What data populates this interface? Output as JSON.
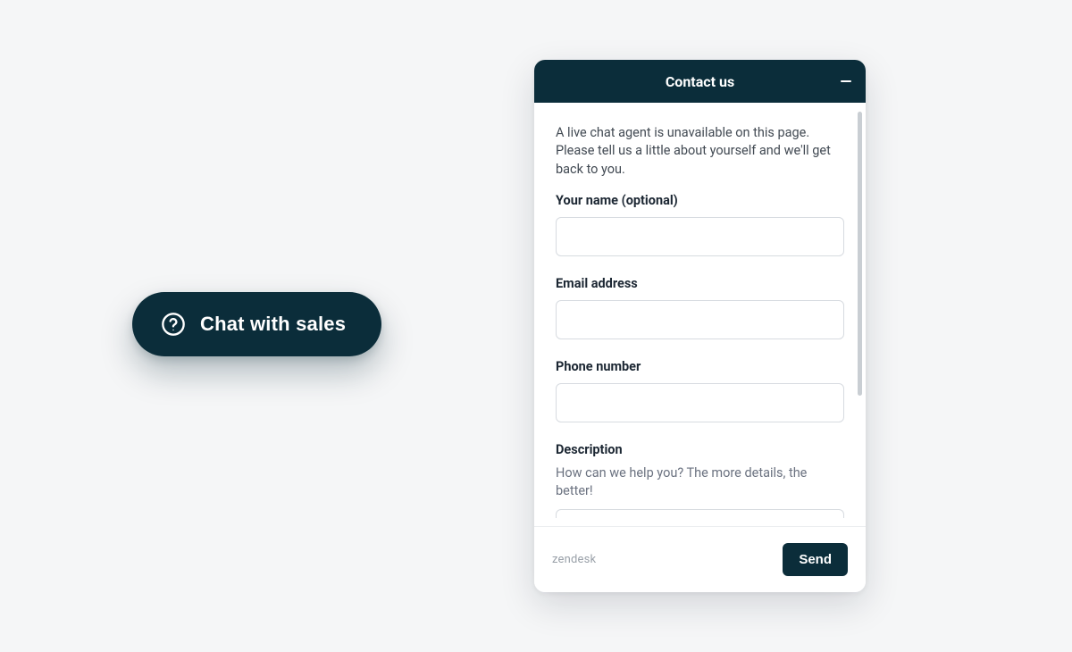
{
  "chat_button": {
    "label": "Chat with sales",
    "icon": "help-circle-icon"
  },
  "widget": {
    "header": {
      "title": "Contact us",
      "minimize_icon": "minimize-icon"
    },
    "intro_text": "A live chat agent is unavailable on this page. Please tell us a little about yourself and we'll get back to you.",
    "fields": {
      "name": {
        "label": "Your name (optional)",
        "value": ""
      },
      "email": {
        "label": "Email address",
        "value": ""
      },
      "phone": {
        "label": "Phone number",
        "value": ""
      },
      "description": {
        "label": "Description",
        "helper": "How can we help you? The more details, the better!",
        "value": ""
      }
    },
    "footer": {
      "brand": "zendesk",
      "send_label": "Send"
    }
  },
  "colors": {
    "brand_dark": "#0b2d3a",
    "page_bg": "#f5f6f7"
  }
}
